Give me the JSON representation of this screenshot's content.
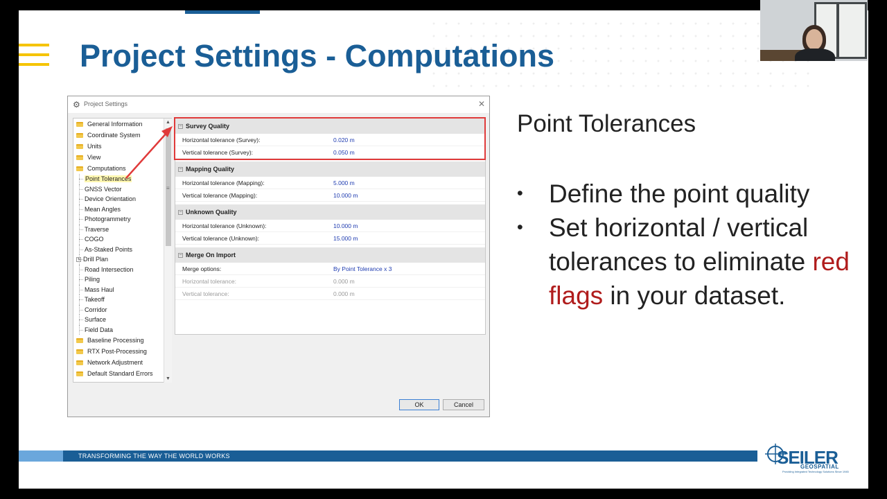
{
  "slide": {
    "title": "Project Settings - Computations",
    "footer_text": "TRANSFORMING THE WAY THE WORLD WORKS",
    "logo_main": "SEILER",
    "logo_sub": "GEOSPATIAL",
    "logo_tagline": "Providing Integrated Technology Solutions Since 1945"
  },
  "dialog": {
    "title": "Project Settings",
    "ok_label": "OK",
    "cancel_label": "Cancel",
    "tree": {
      "top_items": [
        {
          "label": "General Information"
        },
        {
          "label": "Coordinate System"
        },
        {
          "label": "Units"
        },
        {
          "label": "View"
        },
        {
          "label": "Computations"
        }
      ],
      "computations_children": [
        {
          "label": "Point Tolerances",
          "selected": true
        },
        {
          "label": "GNSS Vector"
        },
        {
          "label": "Device Orientation"
        },
        {
          "label": "Mean Angles"
        },
        {
          "label": "Photogrammetry"
        },
        {
          "label": "Traverse"
        },
        {
          "label": "COGO"
        },
        {
          "label": "As-Staked Points"
        },
        {
          "label": "Drill Plan",
          "expandable": true
        },
        {
          "label": "Road Intersection"
        },
        {
          "label": "Piling"
        },
        {
          "label": "Mass Haul"
        },
        {
          "label": "Takeoff"
        },
        {
          "label": "Corridor"
        },
        {
          "label": "Surface"
        },
        {
          "label": "Field Data"
        }
      ],
      "bottom_items": [
        {
          "label": "Baseline Processing"
        },
        {
          "label": "RTX Post-Processing"
        },
        {
          "label": "Network Adjustment"
        },
        {
          "label": "Default Standard Errors"
        }
      ]
    },
    "sections": [
      {
        "name": "Survey Quality",
        "rows": [
          {
            "label": "Horizontal tolerance (Survey):",
            "value": "0.020 m"
          },
          {
            "label": "Vertical tolerance (Survey):",
            "value": "0.050 m"
          }
        ]
      },
      {
        "name": "Mapping Quality",
        "rows": [
          {
            "label": "Horizontal tolerance (Mapping):",
            "value": "5.000 m"
          },
          {
            "label": "Vertical tolerance (Mapping):",
            "value": "10.000 m"
          }
        ]
      },
      {
        "name": "Unknown Quality",
        "rows": [
          {
            "label": "Horizontal tolerance (Unknown):",
            "value": "10.000 m"
          },
          {
            "label": "Vertical tolerance (Unknown):",
            "value": "15.000 m"
          }
        ]
      },
      {
        "name": "Merge On Import",
        "rows": [
          {
            "label": "Merge options:",
            "value": "By Point Tolerance x 3"
          },
          {
            "label": "Horizontal tolerance:",
            "value": "0.000 m",
            "disabled": true
          },
          {
            "label": "Vertical tolerance:",
            "value": "0.000 m",
            "disabled": true
          }
        ]
      }
    ]
  },
  "side": {
    "heading": "Point Tolerances",
    "bullet1": "Define the point quality",
    "bullet2_before": "Set horizontal / vertical tolerances to eliminate ",
    "bullet2_red": "red flags",
    "bullet2_after": " in your dataset."
  },
  "colors": {
    "brand_blue": "#1a5e96",
    "accent_yellow": "#f5c400",
    "highlight_red": "#e03a3a",
    "emphasis_red": "#b01c1c"
  }
}
